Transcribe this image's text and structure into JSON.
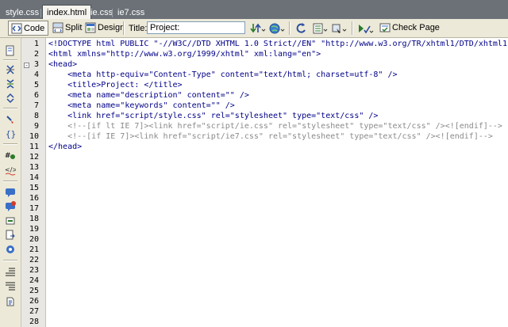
{
  "tabs": [
    {
      "label": "style.css",
      "active": false
    },
    {
      "label": "index.html",
      "active": true
    },
    {
      "label": "ie.css",
      "active": false
    },
    {
      "label": "ie7.css",
      "active": false
    }
  ],
  "toolbar": {
    "code_label": "Code",
    "split_label": "Split",
    "design_label": "Design",
    "title_label": "Title:",
    "title_value": "Project:",
    "check_page_label": "Check Page"
  },
  "rail_icons": [
    "open-documents-icon",
    "collapse-full-tag-icon",
    "collapse-selection-icon",
    "expand-all-icon",
    "select-parent-tag-icon",
    "balance-braces-icon",
    "line-numbers-icon",
    "highlight-invalid-code-icon",
    "apply-comment-icon",
    "remove-comment-icon",
    "wrap-tag-icon",
    "recent-snippets-icon",
    "move-css-icon",
    "format-source-icon",
    "indent-icon",
    "outdent-icon",
    "format-source-code-icon"
  ],
  "gutter": {
    "line_numbers": [
      "1",
      "2",
      "3",
      "4",
      "5",
      "6",
      "7",
      "8",
      "9",
      "10",
      "11",
      "12",
      "13",
      "14",
      "15",
      "16",
      "17",
      "18",
      "19",
      "20",
      "21",
      "22",
      "23",
      "24",
      "25",
      "26",
      "27",
      "28"
    ],
    "fold_symbol": "-"
  },
  "code": {
    "lines": [
      "<!DOCTYPE html PUBLIC \"-//W3C//DTD XHTML 1.0 Strict//EN\" \"http://www.w3.org/TR/xhtml1/DTD/xhtml1-str",
      "<html xmlns=\"http://www.w3.org/1999/xhtml\" xml:lang=\"en\">",
      "<head>",
      "    <meta http-equiv=\"Content-Type\" content=\"text/html; charset=utf-8\" />",
      "    <title>Project: </title>",
      "    <meta name=\"description\" content=\"\" />",
      "    <meta name=\"keywords\" content=\"\" />",
      "    <link href=\"script/style.css\" rel=\"stylesheet\" type=\"text/css\" />",
      "    <!--[if lt IE 7]><link href=\"script/ie.css\" rel=\"stylesheet\" type=\"text/css\" /><![endif]-->",
      "    <!--[if IE 7]><link href=\"script/ie7.css\" rel=\"stylesheet\" type=\"text/css\" /><![endif]-->",
      "</head>"
    ],
    "comment_lines": [
      8,
      9
    ]
  },
  "colors": {
    "code_text": "#000088",
    "comment": "#8a8a8a",
    "tab_bar": "#6b7177",
    "toolbar_bg": "#ece9d8"
  }
}
